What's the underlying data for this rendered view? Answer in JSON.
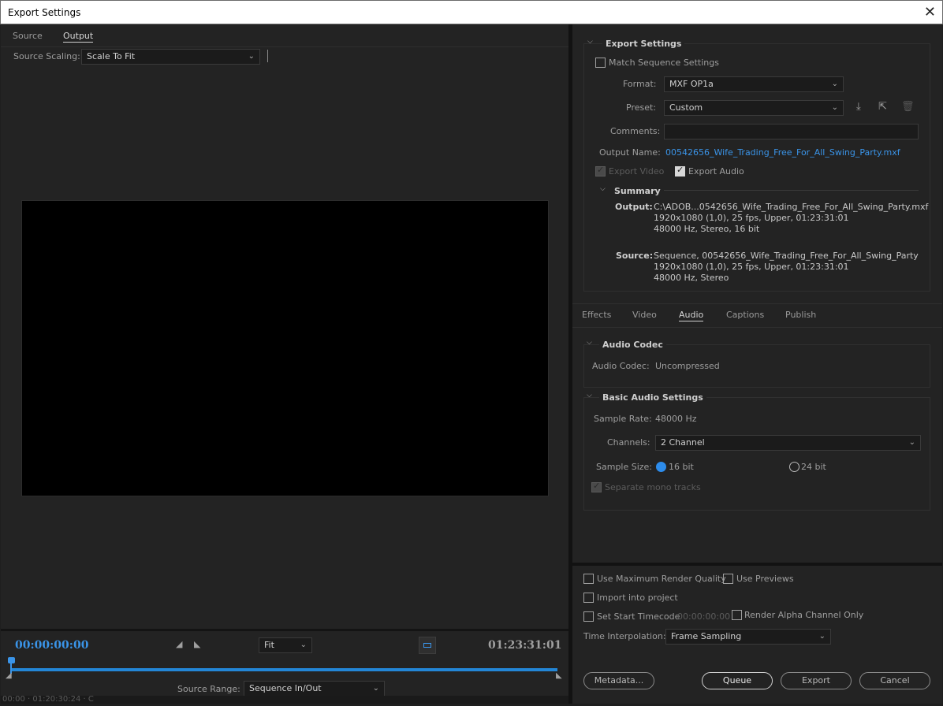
{
  "window": {
    "title": "Export Settings"
  },
  "left": {
    "tabs": [
      {
        "label": "Source"
      },
      {
        "label": "Output"
      }
    ],
    "source_scaling": {
      "label": "Source Scaling:",
      "value": "Scale To Fit"
    },
    "timecode_start": "00:00:00:00",
    "timecode_end": "01:23:31:01",
    "zoom": "Fit",
    "source_range": {
      "label": "Source Range:",
      "value": "Sequence In/Out"
    },
    "bottom_strip": "00:00 · 01:20:30:24 · C"
  },
  "export_settings": {
    "header": "Export Settings",
    "match_sequence": "Match Sequence Settings",
    "format": {
      "label": "Format:",
      "value": "MXF OP1a"
    },
    "preset": {
      "label": "Preset:",
      "value": "Custom"
    },
    "comments": {
      "label": "Comments:",
      "value": ""
    },
    "output_name": {
      "label": "Output Name:",
      "value": "00542656_Wife_Trading_Free_For_All_Swing_Party.mxf"
    },
    "export_video": "Export Video",
    "export_audio": "Export Audio",
    "summary": {
      "header": "Summary",
      "output_label": "Output:",
      "output_lines": [
        "C:\\ADOB...0542656_Wife_Trading_Free_For_All_Swing_Party.mxf",
        "1920x1080 (1,0), 25 fps, Upper, 01:23:31:01",
        "48000 Hz, Stereo, 16 bit"
      ],
      "source_label": "Source:",
      "source_lines": [
        "Sequence, 00542656_Wife_Trading_Free_For_All_Swing_Party",
        "1920x1080 (1,0), 25 fps, Upper, 01:23:31:01",
        "48000 Hz, Stereo"
      ]
    }
  },
  "settings_tabs": [
    {
      "label": "Effects"
    },
    {
      "label": "Video"
    },
    {
      "label": "Audio"
    },
    {
      "label": "Captions"
    },
    {
      "label": "Publish"
    }
  ],
  "audio_codec": {
    "header": "Audio Codec",
    "label": "Audio Codec:",
    "value": "Uncompressed"
  },
  "basic_audio": {
    "header": "Basic Audio Settings",
    "sample_rate_label": "Sample Rate:",
    "sample_rate_value": "48000 Hz",
    "channels_label": "Channels:",
    "channels_value": "2 Channel",
    "sample_size_label": "Sample Size:",
    "opt_16": "16 bit",
    "opt_24": "24 bit",
    "separate_mono": "Separate mono tracks"
  },
  "bottom": {
    "max_render": "Use Maximum Render Quality",
    "use_previews": "Use Previews",
    "import_project": "Import into project",
    "set_start_tc": "Set Start Timecode",
    "start_tc_value": "00:00:00:00",
    "render_alpha": "Render Alpha Channel Only",
    "time_interp_label": "Time Interpolation:",
    "time_interp_value": "Frame Sampling",
    "metadata_btn": "Metadata...",
    "queue_btn": "Queue",
    "export_btn": "Export",
    "cancel_btn": "Cancel"
  },
  "colors": {
    "accent": "#2d8ceb",
    "link": "#3a94e8",
    "panel": "#232323"
  }
}
